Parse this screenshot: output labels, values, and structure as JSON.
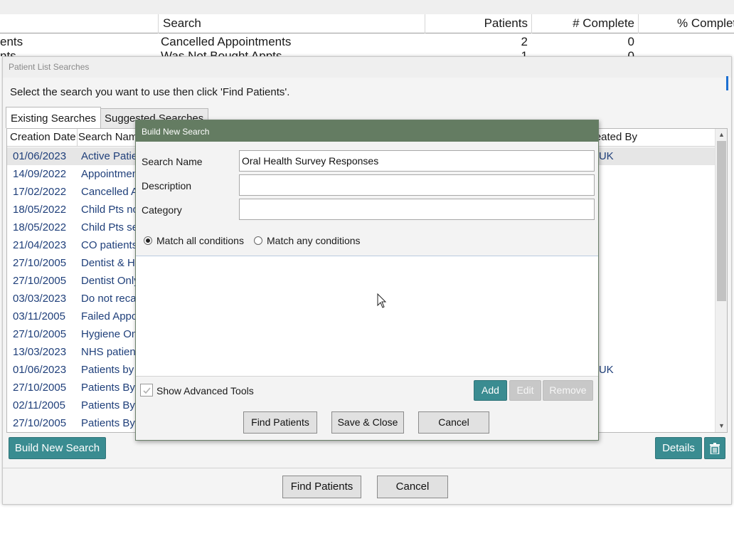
{
  "background_list": {
    "columns": [
      "Search",
      "Patients",
      "# Complete",
      "% Complet"
    ],
    "rows": [
      {
        "name_fragment": "ents",
        "search": "Cancelled Appointments",
        "patients": "2",
        "complete": "0"
      },
      {
        "name_fragment": "nts",
        "search": "Was Not Bought Appts",
        "patients": "1",
        "complete": "0"
      }
    ]
  },
  "patient_list_dialog": {
    "title": "Patient List Searches",
    "instruction": "Select the search you want to use then click 'Find Patients'.",
    "tabs": [
      "Existing Searches",
      "Suggested Searches"
    ],
    "columns": {
      "creation_date": "Creation Date",
      "search_name": "Search Name",
      "created_by": "Created By"
    },
    "rows": [
      {
        "date": "01/06/2023",
        "name": "Active Patie",
        "created_by": "DEUK",
        "selected": true
      },
      {
        "date": "14/09/2022",
        "name": "Appointmen",
        "created_by": ""
      },
      {
        "date": "17/02/2022",
        "name": "Cancelled A",
        "created_by": ""
      },
      {
        "date": "18/05/2022",
        "name": "Child Pts no",
        "created_by": ""
      },
      {
        "date": "18/05/2022",
        "name": "Child Pts se",
        "created_by": ""
      },
      {
        "date": "21/04/2023",
        "name": "CO patients",
        "created_by": ""
      },
      {
        "date": "27/10/2005",
        "name": "Dentist & Hy",
        "created_by": ""
      },
      {
        "date": "27/10/2005",
        "name": "Dentist Only",
        "created_by": ""
      },
      {
        "date": "03/03/2023",
        "name": "Do not reca",
        "created_by": ""
      },
      {
        "date": "03/11/2005",
        "name": "Failed Appo",
        "created_by": ""
      },
      {
        "date": "27/10/2005",
        "name": "Hygiene On",
        "created_by": ""
      },
      {
        "date": "13/03/2023",
        "name": "NHS patient",
        "created_by": ""
      },
      {
        "date": "01/06/2023",
        "name": "Patients by",
        "created_by": "DEUK"
      },
      {
        "date": "27/10/2005",
        "name": "Patients By",
        "created_by": ""
      },
      {
        "date": "02/11/2005",
        "name": "Patients By",
        "created_by": ""
      },
      {
        "date": "27/10/2005",
        "name": "Patients By",
        "created_by": ""
      }
    ],
    "build_new_search_label": "Build New Search",
    "details_label": "Details",
    "find_patients_label": "Find Patients",
    "cancel_label": "Cancel"
  },
  "build_dialog": {
    "title": "Build New Search",
    "search_name_label": "Search Name",
    "search_name_value": "Oral Health Survey Responses",
    "description_label": "Description",
    "description_value": "",
    "category_label": "Category",
    "category_value": "",
    "match_all_label": "Match all conditions",
    "match_any_label": "Match any conditions",
    "match_mode": "all",
    "show_advanced_label": "Show Advanced Tools",
    "show_advanced_checked": true,
    "add_label": "Add",
    "edit_label": "Edit",
    "remove_label": "Remove",
    "find_patients_label": "Find Patients",
    "save_close_label": "Save & Close",
    "cancel_label": "Cancel"
  },
  "colors": {
    "accent_teal": "#3a8c91",
    "dialog_title_green": "#647c62",
    "link_blue": "#1f3f7a",
    "selection_blue": "#1c6fd1"
  }
}
